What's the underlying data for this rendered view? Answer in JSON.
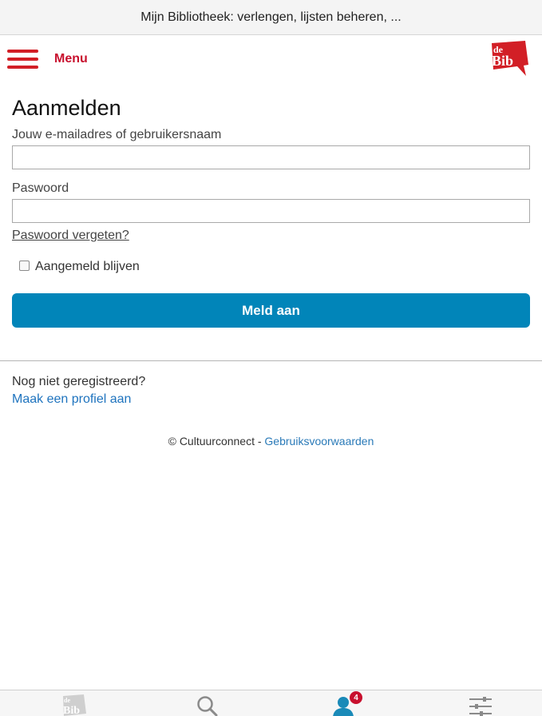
{
  "top_bar": {
    "title": "Mijn Bibliotheek: verlengen, lijsten beheren, ..."
  },
  "header": {
    "menu_label": "Menu",
    "logo_text_top": "de",
    "logo_text_bottom": "Bib"
  },
  "login": {
    "heading": "Aanmelden",
    "username_label": "Jouw e-mailadres of gebruikersnaam",
    "username_value": "",
    "password_label": "Paswoord",
    "password_value": "",
    "forgot_link": "Paswoord vergeten?",
    "remember_label": "Aangemeld blijven",
    "remember_checked": false,
    "submit_label": "Meld aan"
  },
  "register": {
    "prompt": "Nog niet geregistreerd?",
    "link": "Maak een profiel aan"
  },
  "footer": {
    "copyright": "© Cultuurconnect - ",
    "terms_link": "Gebruiksvoorwaarden"
  },
  "tabbar": {
    "items": [
      {
        "icon": "bib-logo-icon"
      },
      {
        "icon": "search-icon"
      },
      {
        "icon": "user-icon",
        "badge": "4"
      },
      {
        "icon": "sliders-icon"
      }
    ]
  },
  "colors": {
    "brand_red": "#c8102e",
    "button_blue": "#0185b9",
    "link_blue": "#1e73be"
  }
}
